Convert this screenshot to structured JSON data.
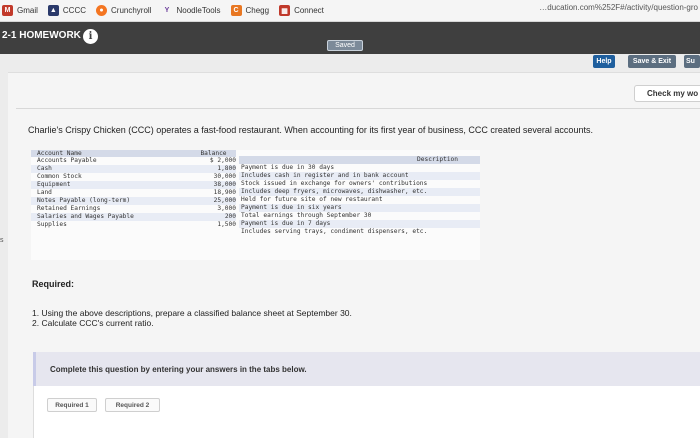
{
  "bookmarks": [
    {
      "label": "Gmail",
      "icon": "gmail-icon",
      "color": "#c23a2b"
    },
    {
      "label": "CCCC",
      "icon": "app-icon",
      "color": "#2b3a6b"
    },
    {
      "label": "Crunchyroll",
      "icon": "crunchyroll-icon",
      "color": "#f47521"
    },
    {
      "label": "NoodleTools",
      "icon": "noodletools-icon",
      "color": "#6a3d9a"
    },
    {
      "label": "Chegg",
      "icon": "chegg-icon",
      "color": "#e87722"
    },
    {
      "label": "Connect",
      "icon": "connect-icon",
      "color": "#c0392b"
    }
  ],
  "url_fragment": "…ducation.com%252F#/activity/question-gro",
  "header": {
    "title": "2-1 HOMEWORK",
    "info_icon": "i",
    "saved_label": "Saved"
  },
  "toolbar": {
    "help_label": "Help",
    "save_exit_label": "Save & Exit",
    "submit_label": "Su",
    "check_label": "Check my wo"
  },
  "question": {
    "intro": "Charlie's Crispy Chicken (CCC) operates a fast-food restaurant. When accounting for its first year of business, CCC created several accounts."
  },
  "table": {
    "headers": {
      "name": "Account Name",
      "balance": "Balance",
      "description": "Description"
    },
    "names": [
      "Accounts Payable",
      "Cash",
      "Common Stock",
      "Equipment",
      "Land",
      "Notes Payable (long-term)",
      "Retained Earnings",
      "Salaries and Wages Payable",
      "Supplies"
    ],
    "balances": [
      "$ 2,000",
      "1,800",
      "30,000",
      "38,000",
      "18,900",
      "25,000",
      "3,000",
      "200",
      "1,500"
    ],
    "descriptions": [
      "Payment is due in 30 days",
      "Includes cash in register and in bank account",
      "Stock issued in exchange for owners' contributions",
      "Includes deep fryers, microwaves, dishwasher, etc.",
      "Held for future site of new restaurant",
      "Payment is due in six years",
      "Total earnings through September 30",
      "Payment is due in 7 days",
      "Includes serving trays, condiment dispensers, etc."
    ]
  },
  "side_label": "s",
  "required": {
    "heading": "Required:",
    "items": [
      "1. Using the above descriptions, prepare a classified balance sheet at September 30.",
      "2. Calculate CCC's current ratio."
    ]
  },
  "instructions": "Complete this question by entering your answers in the tabs below.",
  "tabs": [
    "Required 1",
    "Required 2"
  ]
}
